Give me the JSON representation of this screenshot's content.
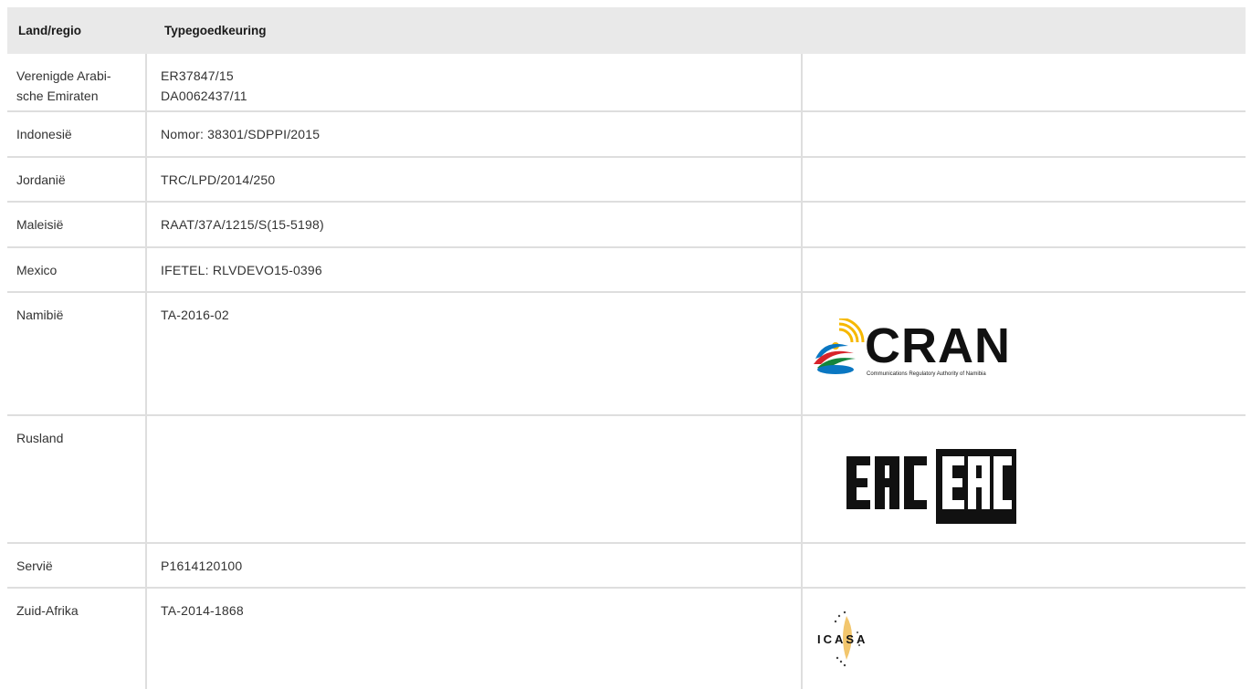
{
  "header": {
    "country": "Land/regio",
    "approval": "Typegoedkeuring"
  },
  "rows": [
    {
      "country": "Verenigde Arabi-\nsche Emiraten",
      "approval": [
        "ER37847/15",
        "DA0062437/11"
      ]
    },
    {
      "country": "Indonesië",
      "approval": [
        "Nomor: 38301/SDPPI/2015"
      ]
    },
    {
      "country": "Jordanië",
      "approval": [
        "TRC/LPD/2014/250"
      ]
    },
    {
      "country": "Maleisië",
      "approval": [
        "RAAT/37A/1215/S(15-5198)"
      ]
    },
    {
      "country": "Mexico",
      "approval": [
        "IFETEL: RLVDEVO15-0396"
      ]
    },
    {
      "country": "Namibië",
      "approval": [
        "TA-2016-02"
      ],
      "logo": "cran-logo"
    },
    {
      "country": "Rusland",
      "approval": [],
      "logo": "eac-logo"
    },
    {
      "country": "Servië",
      "approval": [
        "P1614120100"
      ]
    },
    {
      "country": "Zuid-Afrika",
      "approval": [
        "TA-2014-1868"
      ],
      "logo": "icasa-logo"
    }
  ],
  "logos": {
    "cran": {
      "word": "CRAN",
      "subtitle": "Communications Regulatory Authority of Namibia"
    },
    "eac": {
      "word": "EAC"
    },
    "icasa": {
      "word": "ICASA"
    }
  },
  "colors": {
    "header_bg": "#e9e9e9",
    "border": "#dedede",
    "text": "#333333"
  }
}
